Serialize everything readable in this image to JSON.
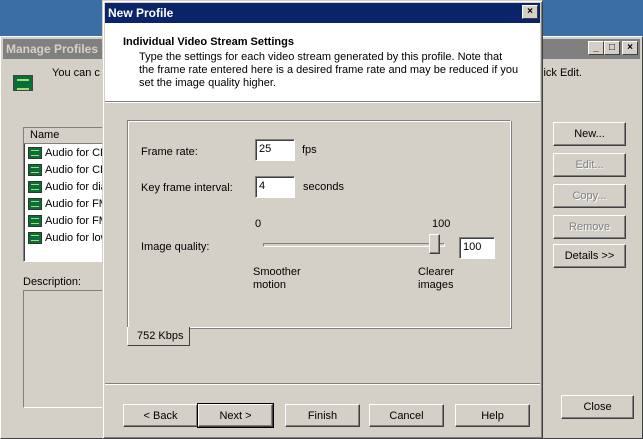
{
  "background_window": {
    "title": "Manage Profiles",
    "intro_text": "You can c",
    "intro_text_right": "lick Edit.",
    "list": {
      "header": "Name",
      "items": [
        "Audio for CD",
        "Audio for CD",
        "Audio for dia",
        "Audio for FM",
        "Audio for FM",
        "Audio for low"
      ]
    },
    "description_label": "Description:",
    "buttons": {
      "new": "New...",
      "edit": "Edit...",
      "copy": "Copy...",
      "remove": "Remove",
      "details": "Details >>",
      "close": "Close"
    },
    "titlebar_buttons": {
      "minimize": "_",
      "maximize": "□",
      "close": "×"
    }
  },
  "dialog": {
    "title": "New Profile",
    "close_glyph": "×",
    "header": {
      "title": "Individual Video Stream Settings",
      "description": "Type the settings for each video stream generated by this profile. Note that the frame rate entered here is a desired frame rate and may be reduced if you set the image quality higher."
    },
    "frame_rate": {
      "label": "Frame rate:",
      "value": "25",
      "unit": "fps"
    },
    "key_frame": {
      "label": "Key frame interval:",
      "value": "4",
      "unit": "seconds"
    },
    "image_quality": {
      "label": "Image quality:",
      "min_label": "0",
      "max_label": "100",
      "value": "100",
      "level_percent": 100,
      "left_caption_1": "Smoother",
      "left_caption_2": "motion",
      "right_caption_1": "Clearer",
      "right_caption_2": "images"
    },
    "bitrate_tab": "752 Kbps",
    "buttons": {
      "back": "< Back",
      "next": "Next >",
      "finish": "Finish",
      "cancel": "Cancel",
      "help": "Help"
    }
  }
}
